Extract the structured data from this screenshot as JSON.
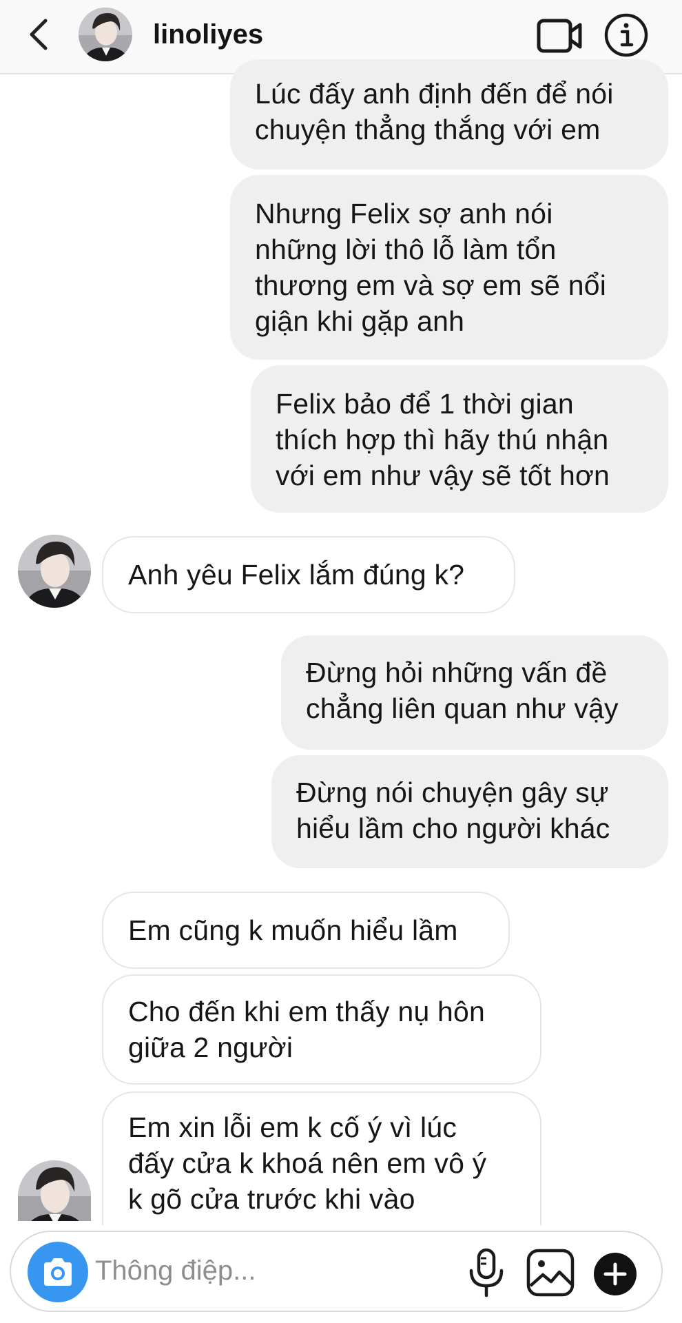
{
  "header": {
    "username": "linoliyes"
  },
  "messages": {
    "m1": "Lúc đấy anh định đến để nói\nchuyện thẳng thắng với em",
    "m2": "Nhưng Felix sợ anh nói\nnhững lời thô lỗ làm tổn\nthương em và sợ em sẽ nổi\ngiận khi gặp anh",
    "m3": "Felix bảo để 1 thời gian\nthích hợp thì hãy thú nhận\nvới em như vậy sẽ tốt hơn",
    "m4": "Anh yêu Felix lắm đúng k?",
    "m5": "Đừng hỏi những vấn đề\nchẳng liên quan như vậy",
    "m6": "Đừng nói chuyện gây sự\nhiểu lầm cho người khác",
    "m7": "Em cũng k muốn hiểu lầm",
    "m8": "Cho đến khi em thấy nụ hôn\ngiữa 2 người",
    "m9": "Em xin lỗi em k cố ý vì lúc\nđấy cửa k khoá nên em vô ý\nk gõ cửa trước khi vào"
  },
  "composer": {
    "placeholder": "Thông điệp..."
  },
  "colors": {
    "my_bubble": "#efefef",
    "their_bubble_border": "#e6e6e6",
    "camera_button": "#3797f0",
    "header_bg": "#f9f9f9"
  },
  "icons": {
    "back": "chevron-left-icon",
    "video": "video-camera-icon",
    "info": "info-icon",
    "camera": "camera-icon",
    "mic": "microphone-icon",
    "gallery": "gallery-icon",
    "plus": "plus-icon"
  }
}
